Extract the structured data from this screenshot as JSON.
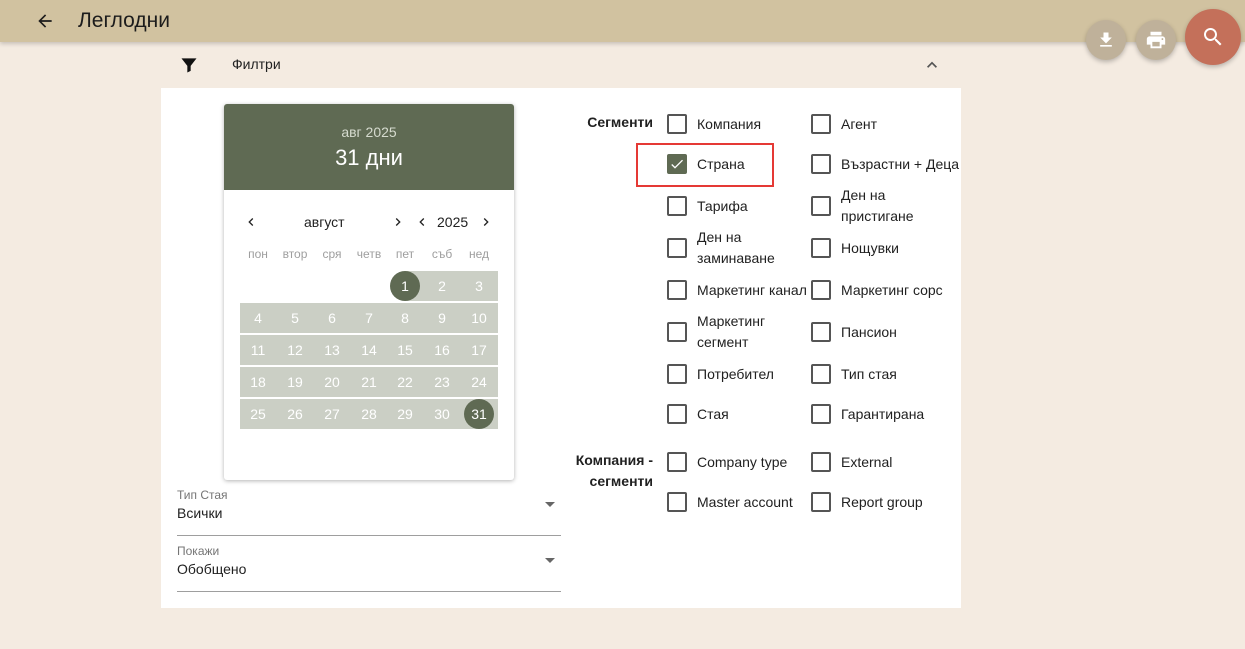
{
  "header": {
    "title": "Леглодни",
    "back_icon": "arrow-left-icon",
    "actions": [
      "download-icon",
      "print-icon",
      "search-icon"
    ]
  },
  "filter": {
    "label": "Филтри"
  },
  "calendar": {
    "header_sub": "авг 2025",
    "header_main": "31 дни",
    "month": "август",
    "year": "2025",
    "weekdays": [
      "пон",
      "втор",
      "сря",
      "четв",
      "пет",
      "съб",
      "нед"
    ],
    "weeks": [
      [
        "",
        "",
        "",
        "",
        "1",
        "2",
        "3"
      ],
      [
        "4",
        "5",
        "6",
        "7",
        "8",
        "9",
        "10"
      ],
      [
        "11",
        "12",
        "13",
        "14",
        "15",
        "16",
        "17"
      ],
      [
        "18",
        "19",
        "20",
        "21",
        "22",
        "23",
        "24"
      ],
      [
        "25",
        "26",
        "27",
        "28",
        "29",
        "30",
        "31"
      ]
    ],
    "range_start": "1",
    "range_end": "31",
    "colors": {
      "header": "#5f6a53",
      "range": "#cbcfc5",
      "selected": "#5f6a53"
    }
  },
  "room_type": {
    "label": "Тип Стая",
    "value": "Всички"
  },
  "show": {
    "label": "Покажи",
    "value": "Обобщено"
  },
  "segments": {
    "label": "Сегменти",
    "items": [
      {
        "label": "Компания",
        "checked": false
      },
      {
        "label": "Агент",
        "checked": false
      },
      {
        "label": "Страна",
        "checked": true
      },
      {
        "label": "Възрастни + Деца",
        "checked": false
      },
      {
        "label": "Тарифа",
        "checked": false
      },
      {
        "label": "Ден на пристигане",
        "checked": false
      },
      {
        "label": "Ден на заминаване",
        "checked": false
      },
      {
        "label": "Нощувки",
        "checked": false
      },
      {
        "label": "Маркетинг канал",
        "checked": false
      },
      {
        "label": "Маркетинг сорс",
        "checked": false
      },
      {
        "label": "Маркетинг сегмент",
        "checked": false
      },
      {
        "label": "Пансион",
        "checked": false
      },
      {
        "label": "Потребител",
        "checked": false
      },
      {
        "label": "Тип стая",
        "checked": false
      },
      {
        "label": "Стая",
        "checked": false
      },
      {
        "label": "Гарантирана",
        "checked": false
      }
    ]
  },
  "company_segments": {
    "label": "Компания - сегменти",
    "items": [
      {
        "label": "Company type",
        "checked": false
      },
      {
        "label": "External",
        "checked": false
      },
      {
        "label": "Master account",
        "checked": false
      },
      {
        "label": "Report group",
        "checked": false
      }
    ]
  },
  "highlight_color": "#e53935"
}
